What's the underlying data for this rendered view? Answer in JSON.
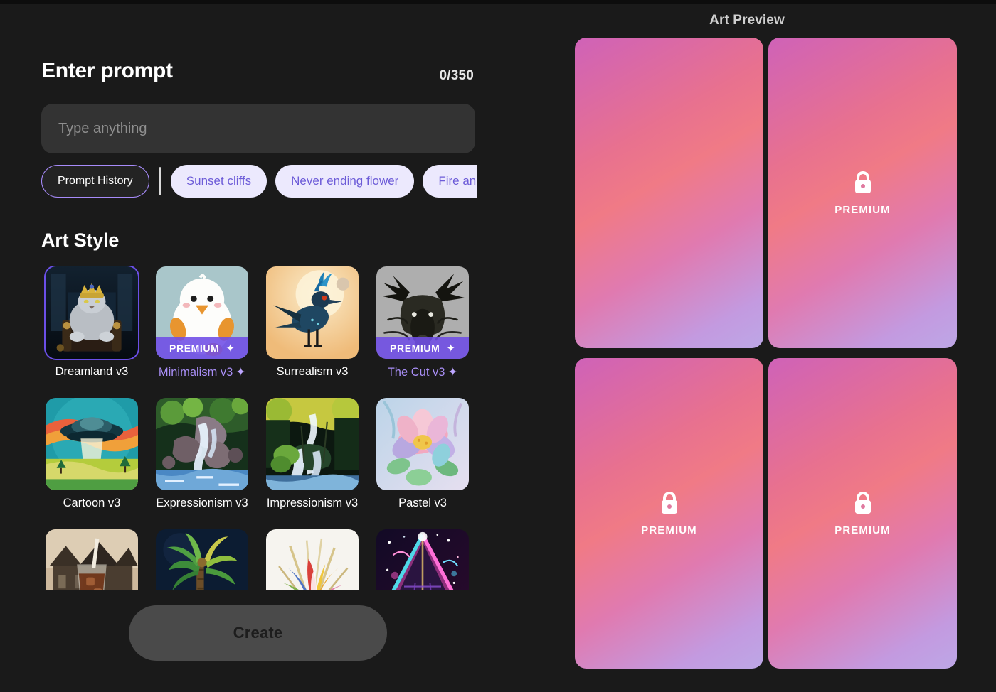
{
  "theme": {
    "background": "#1a1a1a",
    "accent_purple": "#6b4fe8",
    "chip_bg": "#ece9fd",
    "chip_text": "#6d5cd8",
    "premium_badge": "#6e4ce6",
    "preview_gradient_start": "#cf62b8",
    "preview_gradient_mid": "#f07a86",
    "preview_gradient_end": "#bda7e6"
  },
  "prompt_section": {
    "title": "Enter prompt",
    "char_counter": "0/350",
    "input_value": "",
    "input_placeholder": "Type anything",
    "history_button": "Prompt History",
    "suggestions": [
      "Sunset cliffs",
      "Never ending flower",
      "Fire and"
    ]
  },
  "art_style": {
    "title": "Art Style",
    "rows": [
      [
        {
          "label": "Dreamland v3",
          "premium": false,
          "selected": true,
          "art": "cat-king",
          "label_sparkle": false
        },
        {
          "label": "Minimalism v3",
          "premium": true,
          "selected": false,
          "art": "duck",
          "label_sparkle": true
        },
        {
          "label": "Surrealism v3",
          "premium": false,
          "selected": false,
          "art": "blue-bird",
          "label_sparkle": false
        },
        {
          "label": "The Cut v3",
          "premium": true,
          "selected": false,
          "art": "moose",
          "label_sparkle": true
        }
      ],
      [
        {
          "label": "Cartoon v3",
          "premium": false,
          "selected": false,
          "art": "ufo",
          "label_sparkle": false
        },
        {
          "label": "Expressionism v3",
          "premium": false,
          "selected": false,
          "art": "waterfall1",
          "label_sparkle": false
        },
        {
          "label": "Impressionism v3",
          "premium": false,
          "selected": false,
          "art": "waterfall2",
          "label_sparkle": false
        },
        {
          "label": "Pastel v3",
          "premium": false,
          "selected": false,
          "art": "lotus",
          "label_sparkle": false
        }
      ],
      [
        {
          "label": "",
          "premium": false,
          "selected": false,
          "art": "drink",
          "label_sparkle": false
        },
        {
          "label": "",
          "premium": false,
          "selected": false,
          "art": "palm",
          "label_sparkle": false
        },
        {
          "label": "",
          "premium": false,
          "selected": false,
          "art": "bouquet",
          "label_sparkle": false
        },
        {
          "label": "",
          "premium": false,
          "selected": false,
          "art": "pyramid",
          "label_sparkle": false
        }
      ]
    ],
    "premium_badge_text": "PREMIUM"
  },
  "create_button": {
    "label": "Create",
    "enabled": false
  },
  "preview_panel": {
    "title": "Art Preview",
    "cards": [
      {
        "locked": false,
        "badge": ""
      },
      {
        "locked": true,
        "badge": "PREMIUM"
      },
      {
        "locked": true,
        "badge": "PREMIUM"
      },
      {
        "locked": true,
        "badge": "PREMIUM"
      }
    ]
  }
}
